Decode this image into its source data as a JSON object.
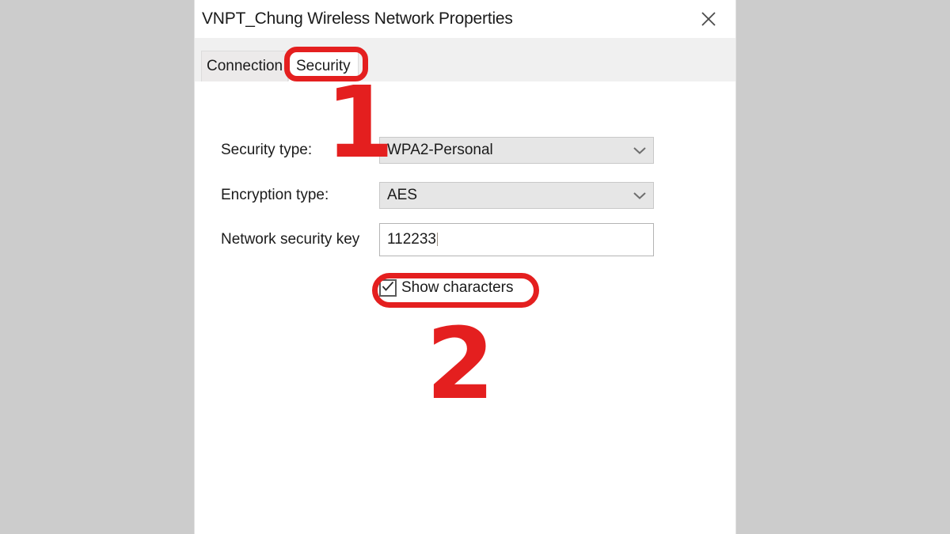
{
  "dialog": {
    "title": "VNPT_Chung Wireless Network Properties",
    "close_icon": "close-icon"
  },
  "tabs": [
    {
      "label": "Connection",
      "active": false
    },
    {
      "label": "Security",
      "active": true
    }
  ],
  "form": {
    "security_type": {
      "label": "Security type:",
      "value": "WPA2-Personal",
      "icon": "chevron-down-icon"
    },
    "encryption_type": {
      "label": "Encryption type:",
      "value": "AES",
      "icon": "chevron-down-icon"
    },
    "network_security_key": {
      "label": "Network security key",
      "value": "112233"
    },
    "show_characters": {
      "label": "Show characters",
      "checked": true,
      "icon": "checkmark-icon"
    }
  },
  "annotations": {
    "color": "#e41f1f",
    "step_one": "1",
    "step_two": "2"
  },
  "colors": {
    "page_background": "#cccccc",
    "dialog_background": "#ffffff",
    "tabstrip_background": "#f0f0f0",
    "combobox_background": "#e6e6e6",
    "annotation_red": "#e41f1f"
  }
}
